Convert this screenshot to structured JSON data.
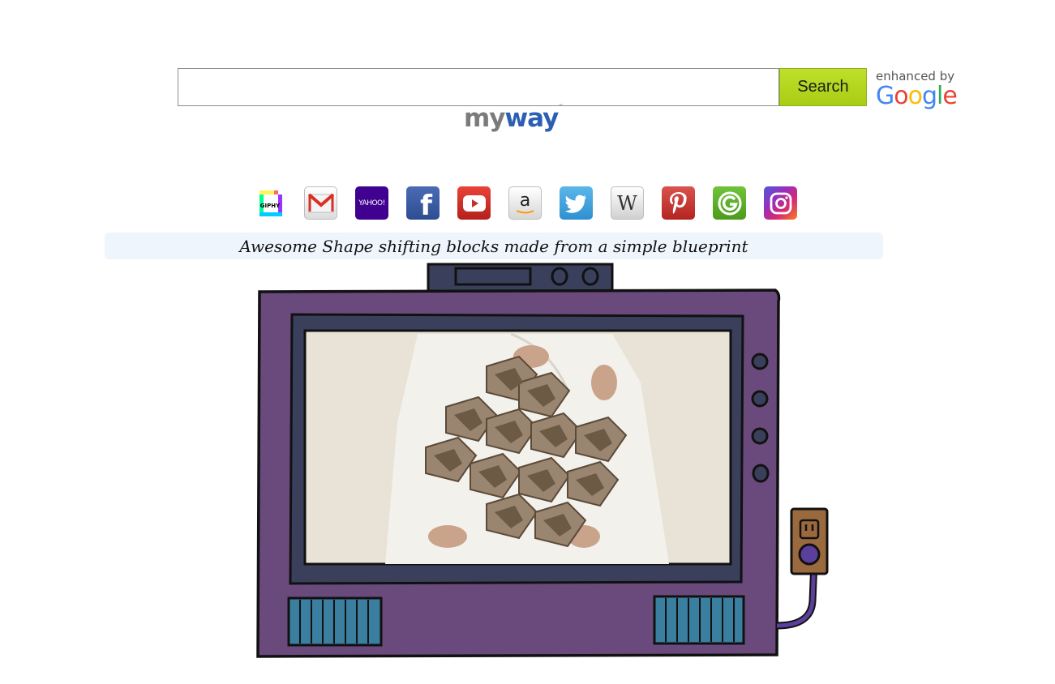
{
  "search": {
    "value": "",
    "button_label": "Search",
    "enhanced_text": "enhanced by",
    "google_letters": [
      {
        "ch": "G",
        "color": "#4285F4"
      },
      {
        "ch": "o",
        "color": "#EA4335"
      },
      {
        "ch": "o",
        "color": "#FBBC05"
      },
      {
        "ch": "g",
        "color": "#4285F4"
      },
      {
        "ch": "l",
        "color": "#34A853"
      },
      {
        "ch": "e",
        "color": "#EA4335"
      }
    ]
  },
  "logo": {
    "part1": "my",
    "part2": "way",
    "tm": "™"
  },
  "shortcuts": {
    "giphy": "GIPHY",
    "yahoo": "YAHOO!",
    "facebook": "f",
    "amazon": "a",
    "wikipedia": "W"
  },
  "caption": "Awesome Shape shifting blocks made from a simple blueprint",
  "colors": {
    "tv_body": "#6a4a7c",
    "tv_frame": "#3a3f5c",
    "screen_bg": "#e8e3d6",
    "vents": "#3a7fa0",
    "outlet": "#9a6a3e",
    "cord": "#5a3f9c",
    "search_button": "#b2d41b"
  }
}
